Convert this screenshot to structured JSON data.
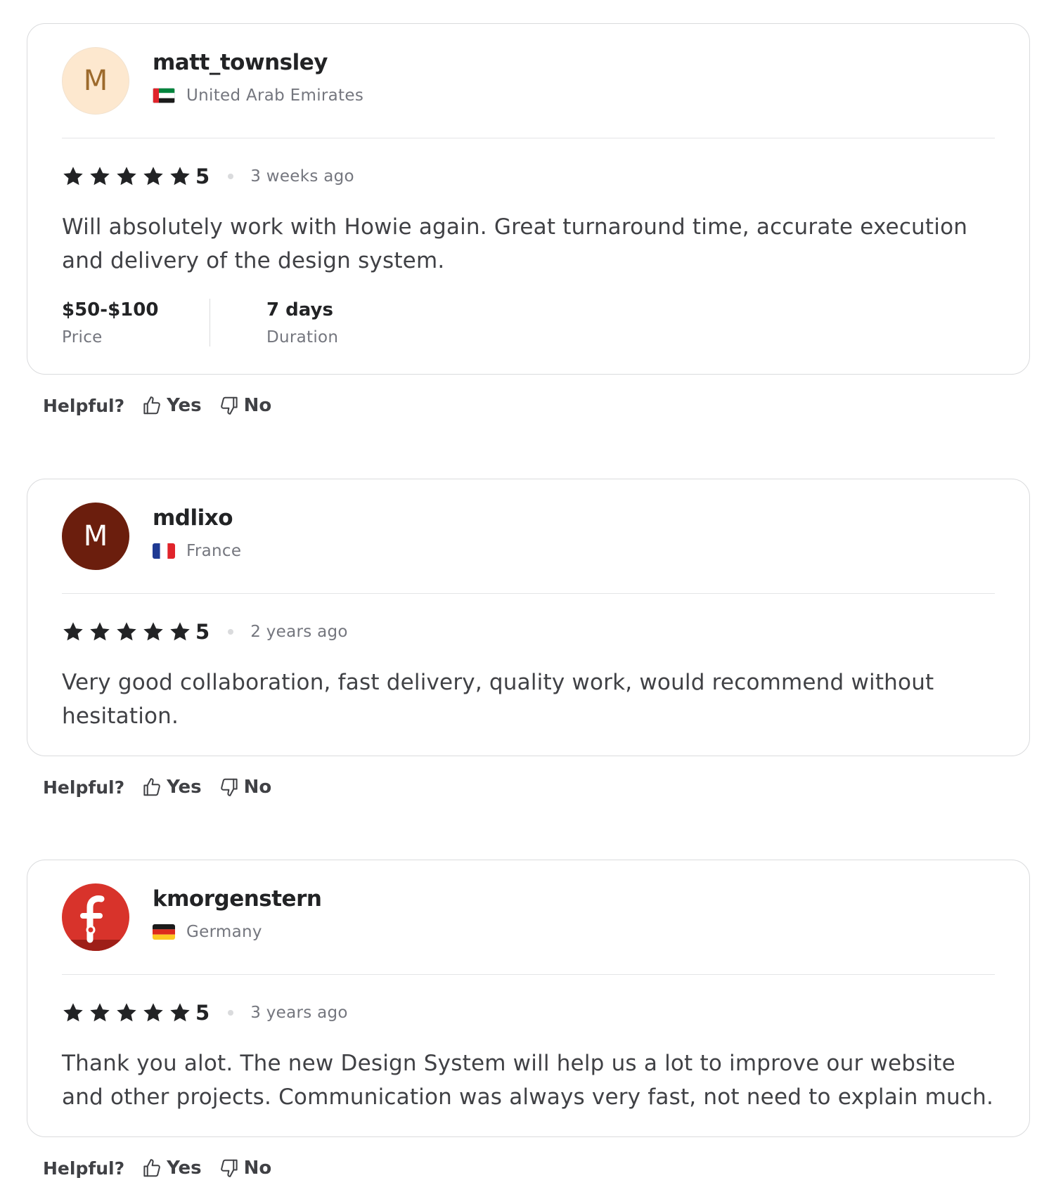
{
  "reviews": [
    {
      "avatar_letter": "M",
      "avatar_style": "light",
      "username": "matt_townsley",
      "country": "United Arab Emirates",
      "flag": "uae",
      "rating": 5,
      "score": "5",
      "time": "3 weeks ago",
      "text": "Will absolutely work with Howie again. Great turnaround time, accurate execution and delivery of the design system.",
      "price_value": "$50-$100",
      "price_label": "Price",
      "duration_value": "7 days",
      "duration_label": "Duration",
      "helpful_label": "Helpful?",
      "yes_label": "Yes",
      "no_label": "No"
    },
    {
      "avatar_letter": "M",
      "avatar_style": "dark",
      "username": "mdlixo",
      "country": "France",
      "flag": "france",
      "rating": 5,
      "score": "5",
      "time": "2 years ago",
      "text": "Very good collaboration, fast delivery, quality work, would recommend without hesitation.",
      "helpful_label": "Helpful?",
      "yes_label": "Yes",
      "no_label": "No"
    },
    {
      "avatar_style": "logo",
      "username": "kmorgenstern",
      "country": "Germany",
      "flag": "germany",
      "rating": 5,
      "score": "5",
      "time": "3 years ago",
      "text": "Thank you alot. The new Design System will help us a lot to improve our website and other projects. Communication was always very fast, not need to explain much.",
      "helpful_label": "Helpful?",
      "yes_label": "Yes",
      "no_label": "No"
    }
  ],
  "colors": {
    "star": "#222325",
    "text_primary": "#222325",
    "text_secondary": "#74767e",
    "border": "#dadbdd",
    "avatar_light_bg": "#fde8cf",
    "avatar_dark_bg": "#6b1e0d",
    "avatar_logo_bg": "#d8332b"
  }
}
